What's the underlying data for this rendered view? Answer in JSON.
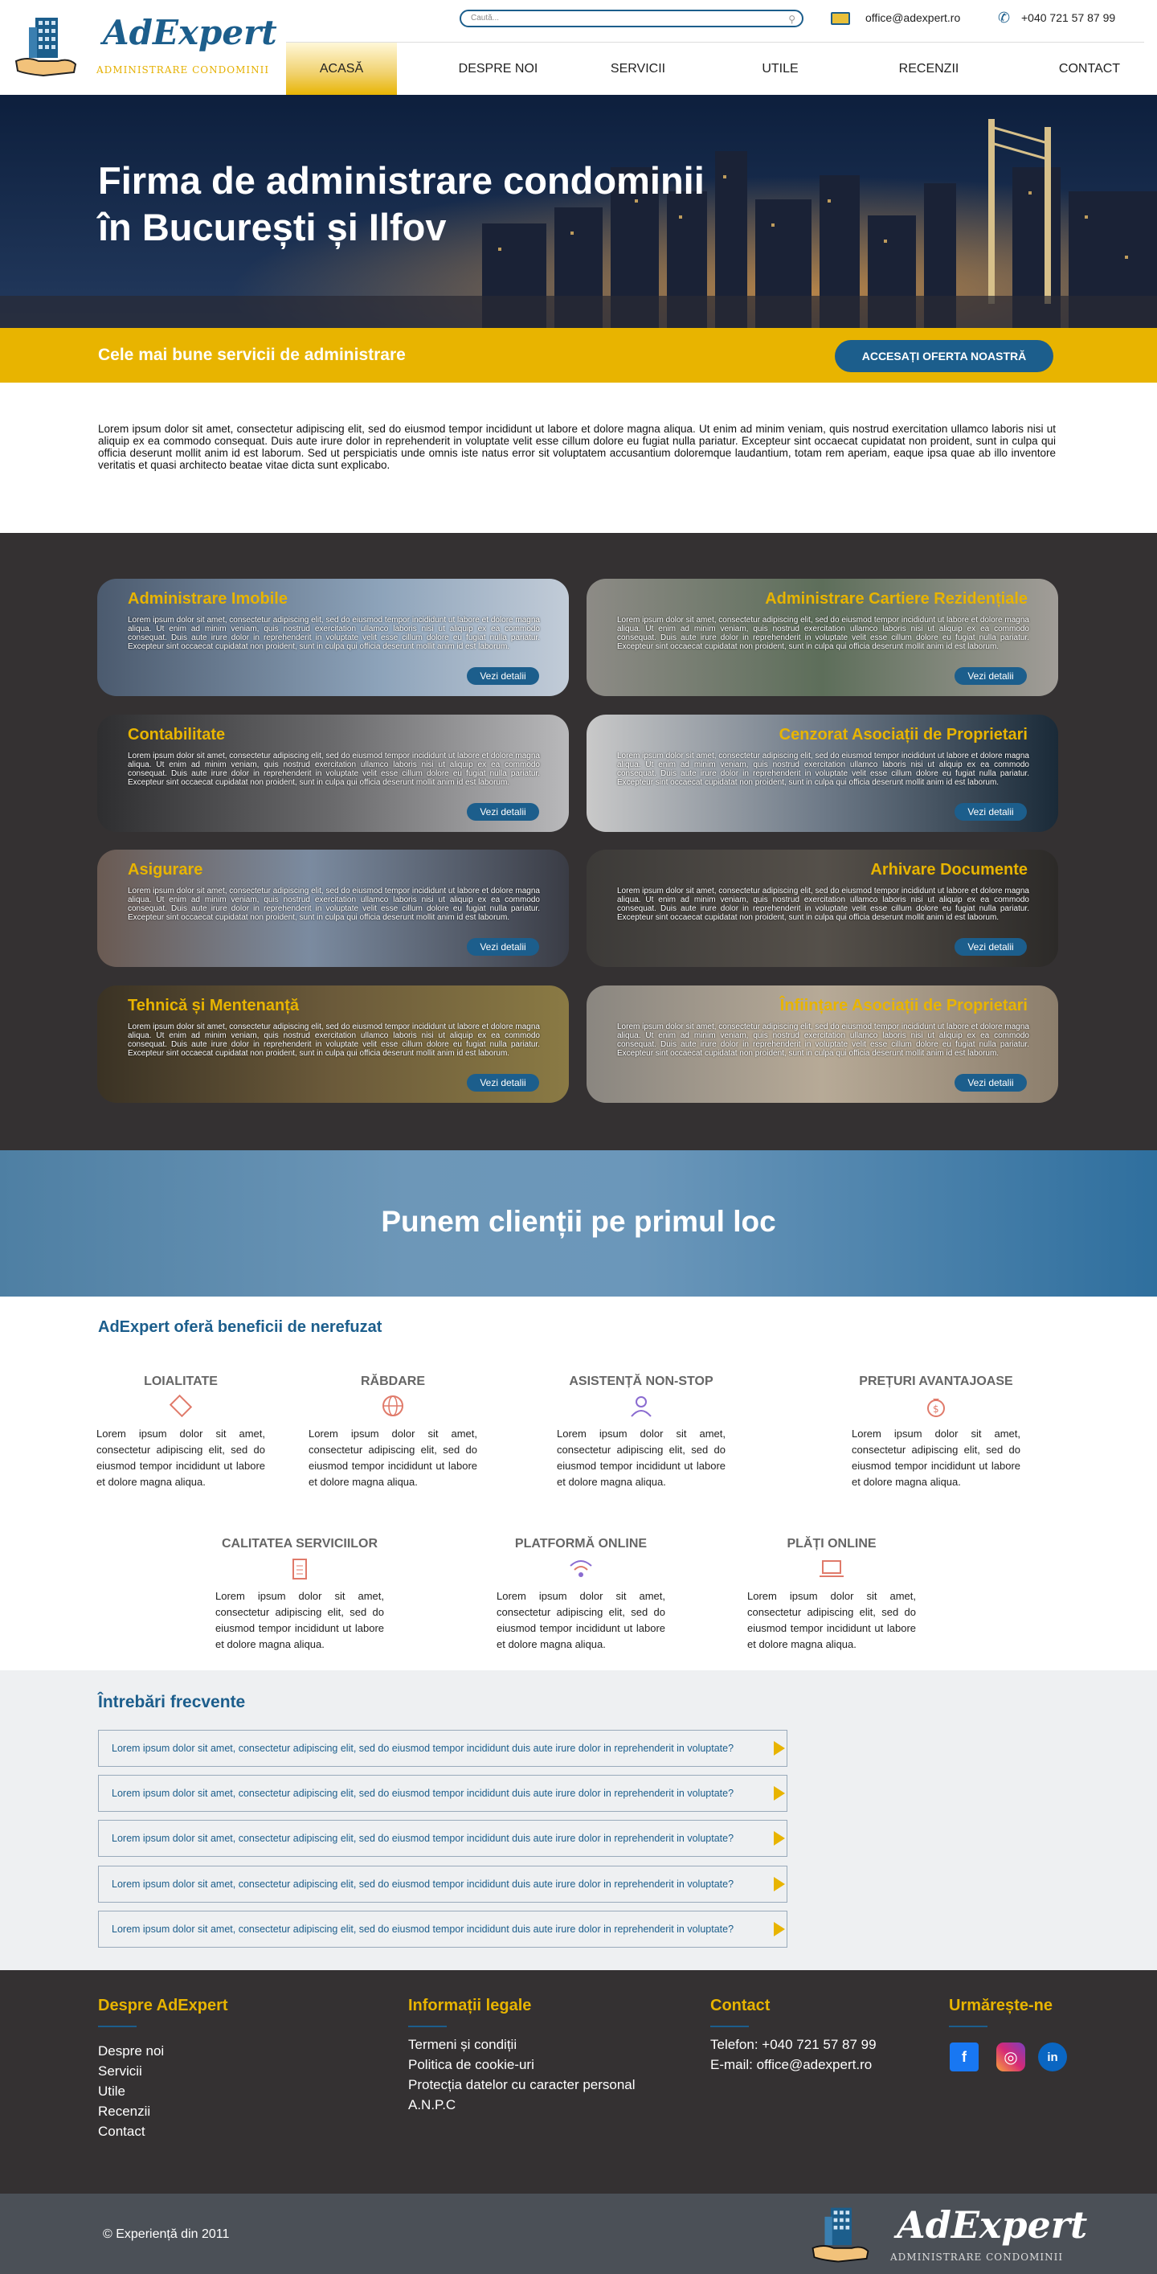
{
  "header": {
    "brand": "AdExpert",
    "brand_sub": "ADMINISTRARE CONDOMINII",
    "search_placeholder": "Caută...",
    "email": "office@adexpert.ro",
    "phone": "+040 721 57 87 99",
    "nav": [
      {
        "label": "ACASĂ"
      },
      {
        "label": "DESPRE NOI"
      },
      {
        "label": "SERVICII"
      },
      {
        "label": "UTILE"
      },
      {
        "label": "RECENZII"
      },
      {
        "label": "CONTACT"
      }
    ]
  },
  "hero": {
    "title_line1": "Firma de administrare condominii",
    "title_line2": "în București și Ilfov"
  },
  "promo": {
    "text": "Cele mai bune servicii de administrare",
    "button": "ACCESAȚI OFERTA NOASTRĂ"
  },
  "intro": "Lorem ipsum dolor sit amet, consectetur adipiscing elit, sed do eiusmod tempor incididunt ut labore et dolore magna aliqua. Ut enim ad minim veniam, quis nostrud exercitation ullamco laboris nisi ut aliquip ex ea commodo consequat. Duis aute irure dolor in reprehenderit in voluptate velit esse cillum dolore eu fugiat nulla pariatur. Excepteur sint occaecat cupidatat non proident, sunt in culpa qui officia deserunt mollit anim id est laborum. Sed ut perspiciatis unde omnis iste natus error sit voluptatem accusantium doloremque laudantium, totam rem aperiam, eaque ipsa quae ab illo inventore veritatis et quasi architecto beatae vitae dicta sunt explicabo.",
  "services": {
    "card_text": "Lorem ipsum dolor sit amet, consectetur adipiscing elit, sed do eiusmod tempor incididunt ut labore et dolore magna aliqua. Ut enim ad minim veniam, quis nostrud exercitation ullamco laboris nisi ut aliquip ex ea commodo consequat. Duis aute irure dolor in reprehenderit in voluptate velit esse cillum dolore eu fugiat nulla pariatur. Excepteur sint occaecat cupidatat non proident, sunt in culpa qui officia deserunt mollit anim id est laborum.",
    "button": "Vezi detalii",
    "items": [
      {
        "title": "Administrare Imobile"
      },
      {
        "title": "Administrare Cartiere Rezidențiale"
      },
      {
        "title": "Contabilitate"
      },
      {
        "title": "Cenzorat Asociații de Proprietari"
      },
      {
        "title": "Asigurare"
      },
      {
        "title": "Arhivare Documente"
      },
      {
        "title": "Tehnică și Mentenanță"
      },
      {
        "title": "Înființare Asociații de Proprietari"
      }
    ]
  },
  "band": {
    "title": "Punem clienții pe primul loc"
  },
  "benefits": {
    "title": "AdExpert oferă beneficii de nerefuzat",
    "text": "Lorem ipsum dolor sit amet, consectetur adipiscing elit, sed do eiusmod tempor incididunt ut labore et dolore magna aliqua.",
    "items": [
      {
        "title": "LOIALITATE",
        "icon": "handshake-icon"
      },
      {
        "title": "RĂBDARE",
        "icon": "globe-icon"
      },
      {
        "title": "ASISTENȚĂ NON-STOP",
        "icon": "support-icon"
      },
      {
        "title": "PREȚURI AVANTAJOASE",
        "icon": "money-bag-icon"
      },
      {
        "title": "CALITATEA SERVICIILOR",
        "icon": "clipboard-icon"
      },
      {
        "title": "PLATFORMĂ ONLINE",
        "icon": "wifi-icon"
      },
      {
        "title": "PLĂȚI ONLINE",
        "icon": "laptop-icon"
      }
    ]
  },
  "faq": {
    "title": "Întrebări frecvente",
    "items": [
      {
        "q": "Lorem ipsum dolor sit amet, consectetur adipiscing elit, sed do eiusmod tempor incididunt duis aute irure dolor in reprehenderit in voluptate?"
      },
      {
        "q": "Lorem ipsum dolor sit amet, consectetur adipiscing elit, sed do eiusmod tempor incididunt duis aute irure dolor in reprehenderit in voluptate?"
      },
      {
        "q": "Lorem ipsum dolor sit amet, consectetur adipiscing elit, sed do eiusmod tempor incididunt duis aute irure dolor in reprehenderit in voluptate?"
      },
      {
        "q": "Lorem ipsum dolor sit amet, consectetur adipiscing elit, sed do eiusmod tempor incididunt duis aute irure dolor in reprehenderit in voluptate?"
      },
      {
        "q": "Lorem ipsum dolor sit amet, consectetur adipiscing elit, sed do eiusmod tempor incididunt duis aute irure dolor in reprehenderit in voluptate?"
      }
    ]
  },
  "footer": {
    "about_title": "Despre AdExpert",
    "about_links": [
      "Despre noi",
      "Servicii",
      "Utile",
      "Recenzii",
      "Contact"
    ],
    "legal_title": "Informații legale",
    "legal_links": [
      "Termeni și condiții",
      "Politica de cookie-uri",
      "Protecția datelor cu caracter personal",
      "A.N.P.C"
    ],
    "contact_title": "Contact",
    "contact_phone": "Telefon: +040 721 57 87 99",
    "contact_email": "E-mail: office@adexpert.ro",
    "follow_title": "Urmărește-ne",
    "social": [
      {
        "name": "facebook-icon",
        "glyph": "f",
        "color": "#1877f2"
      },
      {
        "name": "instagram-icon",
        "glyph": "◎",
        "color": "#d62976"
      },
      {
        "name": "linkedin-icon",
        "glyph": "in",
        "color": "#0a66c2"
      }
    ],
    "copyright": "© Experiență din 2011",
    "brand": "AdExpert",
    "brand_sub": "ADMINISTRARE CONDOMINII"
  },
  "colors": {
    "accent": "#e8b400",
    "brand": "#1c5e8c",
    "dark": "#343132"
  }
}
